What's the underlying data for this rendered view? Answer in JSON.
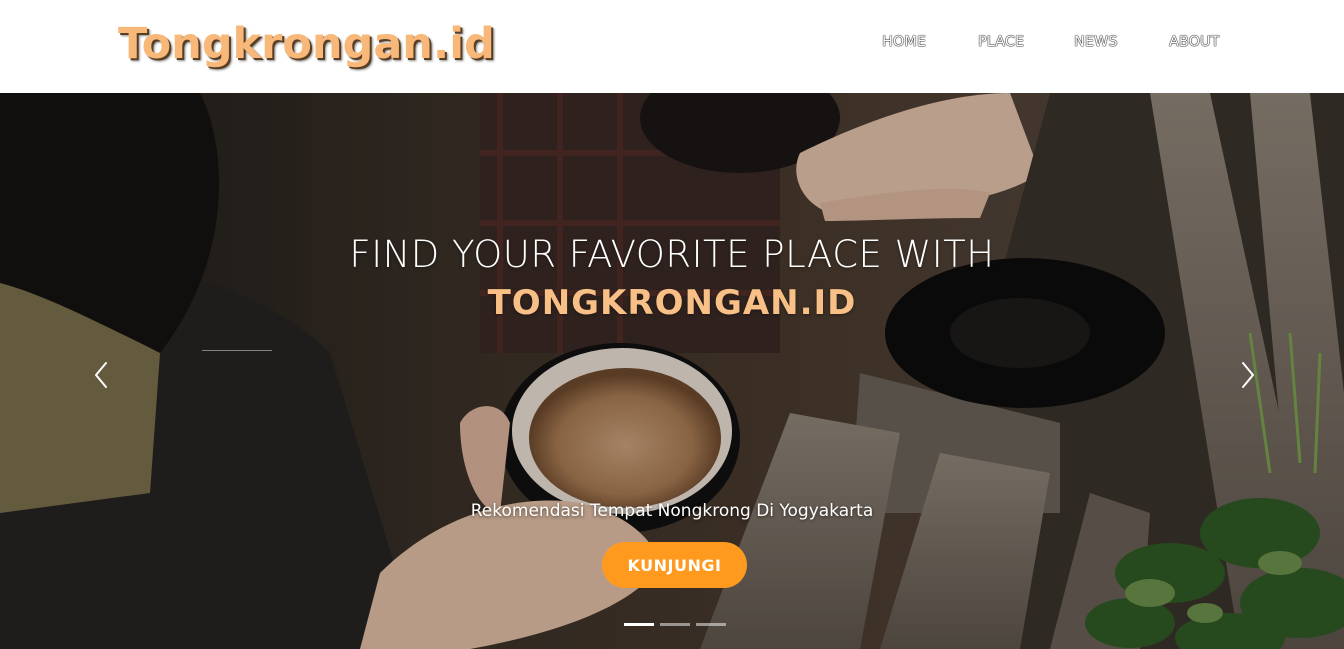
{
  "brand": {
    "logo_text": "Tongkrongan.id",
    "color": "#f8b87a"
  },
  "nav": {
    "items": [
      {
        "label": "HOME"
      },
      {
        "label": "PLACE"
      },
      {
        "label": "NEWS"
      },
      {
        "label": "ABOUT"
      }
    ]
  },
  "hero": {
    "heading": "FIND YOUR FAVORITE PLACE WITH",
    "brand_heading": "TONGKRONGAN.ID",
    "subtitle": "Rekomendasi Tempat Nongkrong Di Yogyakarta",
    "cta_label": "KUNJUNGI",
    "cta_color": "#ff9a1f",
    "prev_icon": "chevron-left-icon",
    "next_icon": "chevron-right-icon",
    "slides_total": 3,
    "active_slide": 1
  }
}
